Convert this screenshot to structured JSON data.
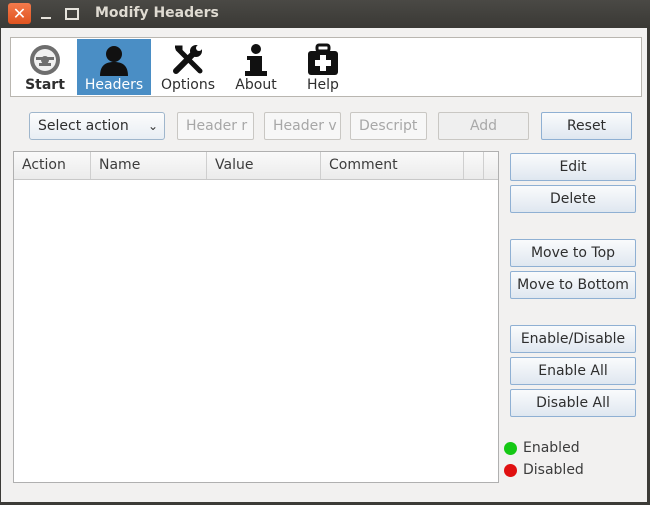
{
  "window": {
    "title": "Modify Headers"
  },
  "toolbar": {
    "items": [
      {
        "label": "Start"
      },
      {
        "label": "Headers"
      },
      {
        "label": "Options"
      },
      {
        "label": "About"
      },
      {
        "label": "Help"
      }
    ],
    "active": "Headers"
  },
  "form": {
    "action_select": {
      "value": "Select action"
    },
    "header_name": {
      "placeholder": "Header name",
      "visible": "Header r"
    },
    "header_value": {
      "placeholder": "Header value",
      "visible": "Header v"
    },
    "description": {
      "placeholder": "Description",
      "visible": "Descript"
    },
    "add_label": "Add",
    "reset_label": "Reset"
  },
  "table": {
    "columns": [
      "Action",
      "Name",
      "Value",
      "Comment"
    ],
    "rows": []
  },
  "side_buttons": {
    "edit": "Edit",
    "delete": "Delete",
    "move_top": "Move to Top",
    "move_bottom": "Move to Bottom",
    "enable_disable": "Enable/Disable",
    "enable_all": "Enable All",
    "disable_all": "Disable All"
  },
  "legend": {
    "enabled": {
      "label": "Enabled",
      "color": "#14c814"
    },
    "disabled": {
      "label": "Disabled",
      "color": "#e01010"
    }
  },
  "colors": {
    "accent": "#4a8ec5",
    "titlebar": "#3c3b37",
    "close": "#e65a22"
  }
}
